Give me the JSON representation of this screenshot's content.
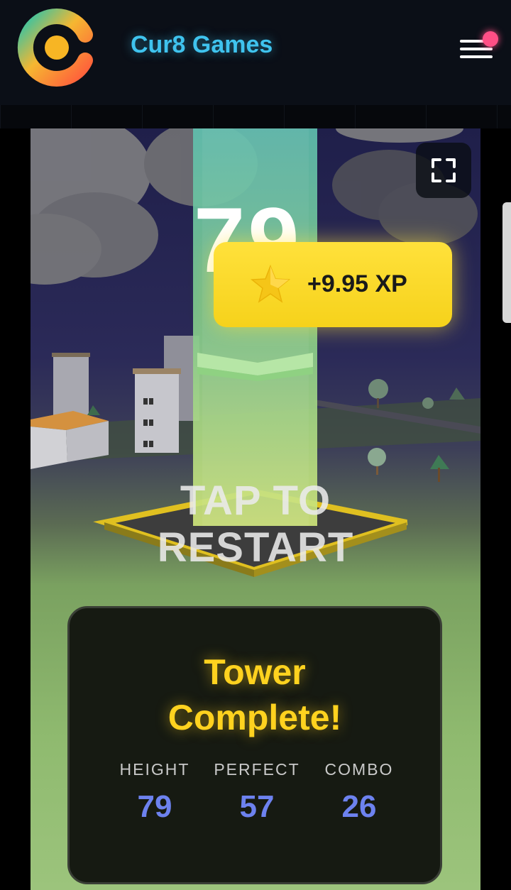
{
  "header": {
    "brand": "Cur8 Games"
  },
  "game": {
    "score": "79",
    "xp_toast": "+9.95 XP",
    "restart_line1": "TAP TO",
    "restart_line2": "RESTART"
  },
  "result_card": {
    "title_line1": "Tower",
    "title_line2": "Complete!",
    "stats": [
      {
        "label": "HEIGHT",
        "value": "79"
      },
      {
        "label": "PERFECT",
        "value": "57"
      },
      {
        "label": "COMBO",
        "value": "26"
      }
    ]
  },
  "colors": {
    "brand_cyan": "#3fc3ee",
    "accent_yellow": "#ffd21f",
    "stat_blue": "#6d82ef",
    "notification_pink": "#ff4f86"
  }
}
